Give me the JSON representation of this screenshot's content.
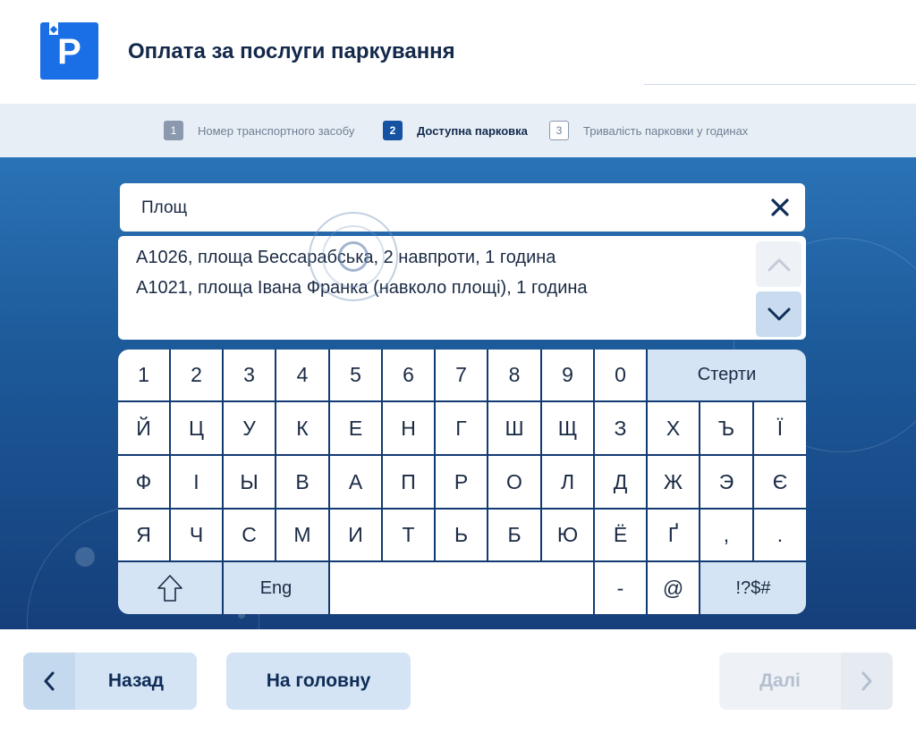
{
  "header": {
    "logo_letter": "P",
    "title": "Оплата за послуги паркування"
  },
  "steps": [
    {
      "number": "1",
      "label": "Номер транспортного засобу",
      "state": "done"
    },
    {
      "number": "2",
      "label": "Доступна парковка",
      "state": "active"
    },
    {
      "number": "3",
      "label": "Тривалість парковки у годинах",
      "state": "pending"
    }
  ],
  "search": {
    "value": "Площ",
    "clear_symbol": "✕"
  },
  "results": [
    "А1026, площа Бессарабська, 2 навпроти, 1 година",
    "А1021, площа Івана Франка (навколо площі), 1 година"
  ],
  "keyboard": {
    "row1": [
      "1",
      "2",
      "3",
      "4",
      "5",
      "6",
      "7",
      "8",
      "9",
      "0"
    ],
    "erase": "Стерти",
    "row2": [
      "Й",
      "Ц",
      "У",
      "К",
      "Е",
      "Н",
      "Г",
      "Ш",
      "Щ",
      "З",
      "Х",
      "Ъ",
      "Ї"
    ],
    "row3": [
      "Ф",
      "І",
      "Ы",
      "В",
      "А",
      "П",
      "Р",
      "О",
      "Л",
      "Д",
      "Ж",
      "Э",
      "Є"
    ],
    "row4": [
      "Я",
      "Ч",
      "С",
      "М",
      "И",
      "Т",
      "Ь",
      "Б",
      "Ю",
      "Ё",
      "Ґ",
      ",",
      "."
    ],
    "shift_symbol": "⇧",
    "lang": "Eng",
    "dash": "-",
    "at": "@",
    "symbols": "!?$#"
  },
  "footer": {
    "back_label": "Назад",
    "home_label": "На головну",
    "next_label": "Далі"
  },
  "colors": {
    "brand": "#1a6fe6",
    "accent": "#1553a2",
    "key_alt": "#d4e4f4",
    "main_bg": "#1d5a9a"
  }
}
